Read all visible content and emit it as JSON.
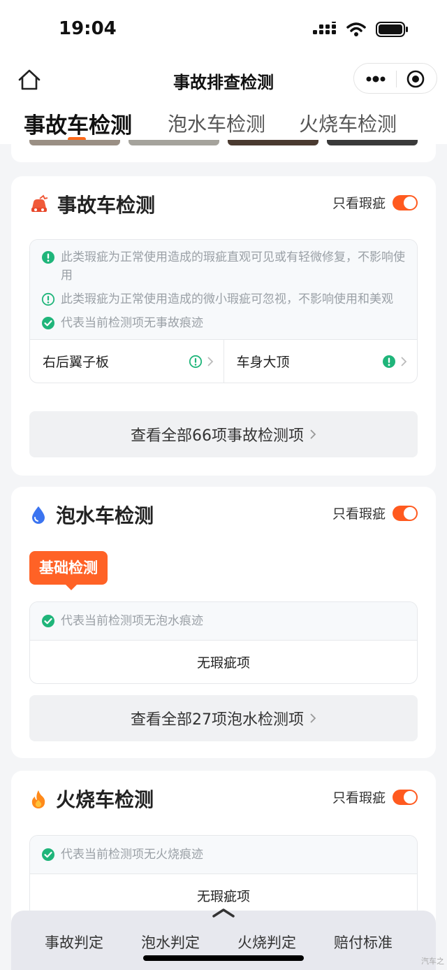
{
  "status_bar": {
    "time": "19:04"
  },
  "nav": {
    "title": "事故排查检测"
  },
  "tabs": [
    {
      "label": "事故车检测",
      "active": true
    },
    {
      "label": "泡水车检测",
      "active": false
    },
    {
      "label": "火烧车检测",
      "active": false
    }
  ],
  "accident": {
    "title": "事故车检测",
    "toggle_label": "只看瑕疵",
    "legend": [
      {
        "icon": "exclamation-solid-icon",
        "text": "此类瑕疵为正常使用造成的瑕疵直观可见或有轻微修复，不影响使用"
      },
      {
        "icon": "exclamation-outline-icon",
        "text": "此类瑕疵为正常使用造成的微小瑕疵可忽视，不影响使用和美观"
      },
      {
        "icon": "check-circle-icon",
        "text": "代表当前检测项无事故痕迹"
      }
    ],
    "items": [
      {
        "name": "右后翼子板",
        "icon": "exclamation-outline-icon"
      },
      {
        "name": "车身大顶",
        "icon": "exclamation-solid-icon"
      }
    ],
    "view_all": "查看全部66项事故检测项"
  },
  "water": {
    "title": "泡水车检测",
    "toggle_label": "只看瑕疵",
    "badge": "基础检测",
    "legend": "代表当前检测项无泡水痕迹",
    "no_defect": "无瑕疵项",
    "view_all": "查看全部27项泡水检测项"
  },
  "fire": {
    "title": "火烧车检测",
    "toggle_label": "只看瑕疵",
    "legend": "代表当前检测项无火烧痕迹",
    "no_defect": "无瑕疵项"
  },
  "bottom_nav": [
    "事故判定",
    "泡水判定",
    "火烧判定",
    "赔付标准"
  ],
  "watermark": "汽车之",
  "colors": {
    "accent": "#ff5a1f",
    "green": "#1fb57a",
    "bg": "#f4f5f7"
  }
}
